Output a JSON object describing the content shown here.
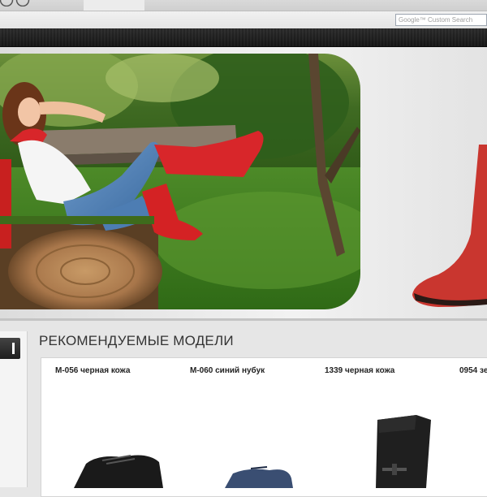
{
  "search": {
    "placeholder": "Google™ Custom Search"
  },
  "hero": {
    "image": "woman-in-red-boots-photo"
  },
  "section": {
    "title": "РЕКОМЕНДУЕМЫЕ МОДЕЛИ"
  },
  "products": [
    {
      "name": "M-056 черная кожа",
      "image": "black-leather-shoe"
    },
    {
      "name": "M-060 синий нубук",
      "image": "blue-nubuck-shoe"
    },
    {
      "name": "1339 черная кожа",
      "image": "black-leather-boot"
    },
    {
      "name": "0954 зе"
    }
  ],
  "colors": {
    "accent_red": "#d8262a",
    "dark_band": "#1c1c1c",
    "page_bg": "#e6e6e6"
  }
}
